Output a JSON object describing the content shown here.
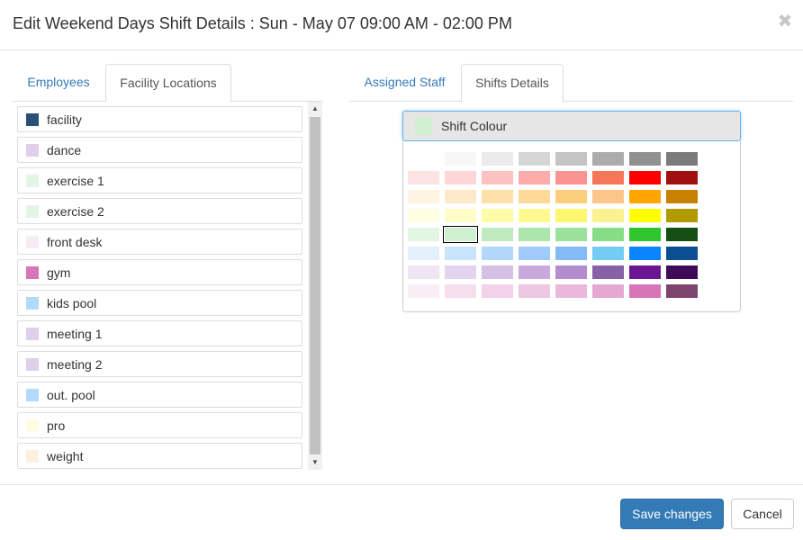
{
  "modal": {
    "title": "Edit Weekend Days Shift Details : Sun - May 07 09:00 AM - 02:00 PM",
    "close_glyph": "✖"
  },
  "left_tabs": [
    {
      "label": "Employees",
      "active": false
    },
    {
      "label": "Facility Locations",
      "active": true
    }
  ],
  "right_tabs": [
    {
      "label": "Assigned Staff",
      "active": false
    },
    {
      "label": "Shifts Details",
      "active": true
    }
  ],
  "locations": [
    {
      "label": "facility",
      "color": "#2a5078"
    },
    {
      "label": "dance",
      "color": "#dfcfe8"
    },
    {
      "label": "exercise 1",
      "color": "#e3f5e3"
    },
    {
      "label": "exercise 2",
      "color": "#e3f5e3"
    },
    {
      "label": "front desk",
      "color": "#f5ecf5"
    },
    {
      "label": "gym",
      "color": "#d874b8"
    },
    {
      "label": "kids pool",
      "color": "#b3d9fb"
    },
    {
      "label": "meeting 1",
      "color": "#dfcfe8"
    },
    {
      "label": "meeting 2",
      "color": "#dfcfe8"
    },
    {
      "label": "out. pool",
      "color": "#b3d9fb"
    },
    {
      "label": "pro",
      "color": "#fefde3"
    },
    {
      "label": "weight",
      "color": "#fdf0df"
    }
  ],
  "scrollbar": {
    "up_glyph": "▲",
    "down_glyph": "▼"
  },
  "shift_colour": {
    "label": "Shift Colour",
    "selected_color": "#d1f0d1"
  },
  "palette": [
    [
      "#ffffff",
      "#f7f7f7",
      "#ebebeb",
      "#d6d6d6",
      "#c4c4c4",
      "#acacac",
      "#909090",
      "#7b7b7b"
    ],
    [
      "#fde3e3",
      "#fdd7d7",
      "#fcc2c2",
      "#fcabab",
      "#fb9393",
      "#f7765a",
      "#ff0000",
      "#a01010"
    ],
    [
      "#fef4e3",
      "#fee9c8",
      "#fee0aa",
      "#fed997",
      "#fdcf7d",
      "#fcc58a",
      "#ffa500",
      "#c88200"
    ],
    [
      "#fefee3",
      "#fefdc8",
      "#fefca7",
      "#fefa90",
      "#fef66e",
      "#fbf190",
      "#ffff00",
      "#b09a00"
    ],
    [
      "#e3f5e3",
      "#d1f0d1",
      "#bfeabf",
      "#ade6ad",
      "#9be09b",
      "#86dd86",
      "#2dc72d",
      "#154f15"
    ],
    [
      "#e3f0fc",
      "#c8e3fc",
      "#b3d6fb",
      "#a0cafa",
      "#83bbf7",
      "#74ccf4",
      "#0a84ff",
      "#0b4f92"
    ],
    [
      "#efe5f3",
      "#e3d3ee",
      "#d7c0e5",
      "#c9a8dc",
      "#b48dcf",
      "#8760a8",
      "#6b1795",
      "#3f0a58"
    ],
    [
      "#f9eef6",
      "#f5deee",
      "#f1d2e8",
      "#edc6e1",
      "#ebb8dc",
      "#e5a8d5",
      "#d874b8",
      "#7d456d"
    ]
  ],
  "footer": {
    "save_label": "Save changes",
    "cancel_label": "Cancel"
  }
}
